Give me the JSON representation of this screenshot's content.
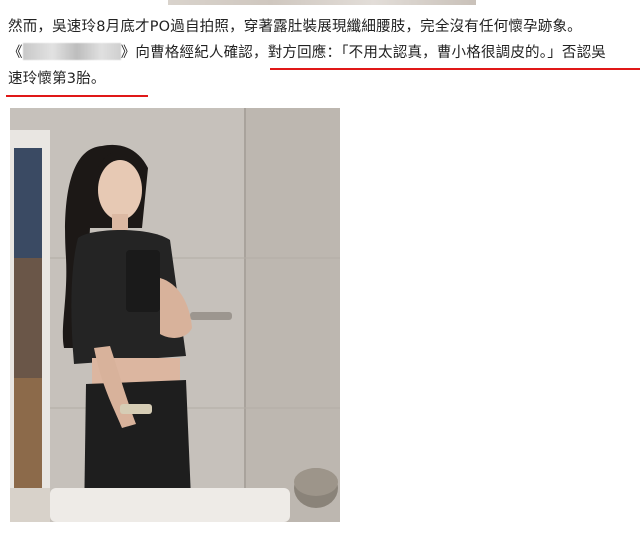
{
  "article": {
    "line1": "然而，吳速玲8月底才PO過自拍照，穿著露肚裝展現纖細腰肢，完全沒有任何懷孕跡象。",
    "line2_open": "《",
    "line2_rest": "》向曹格經紀人確認，對方回應：「不用太認真，曹小格很調皮的。」否認吳",
    "line3": "速玲懷第3胎。"
  },
  "photo": {
    "icon": "mirror-selfie-photo"
  },
  "colors": {
    "highlight_underline": "#e01818",
    "text": "#222222"
  }
}
